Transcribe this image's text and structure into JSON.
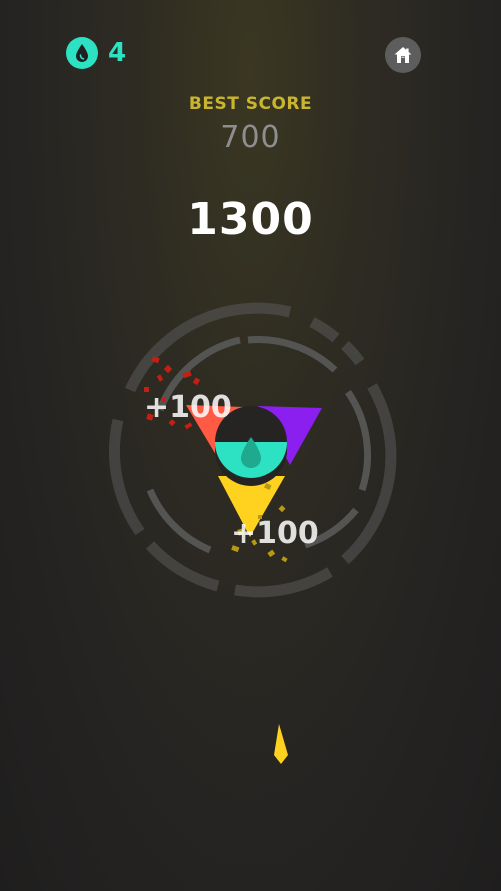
{
  "hud": {
    "drop_icon": "water-drop-icon",
    "drops": "4",
    "home_icon": "home-icon"
  },
  "best": {
    "label": "BEST SCORE",
    "value": "700"
  },
  "score": "1300",
  "popups": {
    "left": "+100",
    "right": "+100"
  },
  "colors": {
    "accent": "#2de2c3",
    "best_label": "#c9b530",
    "red": "#ff5a44",
    "purple": "#8b1ff0",
    "yellow": "#ffd21f",
    "ring": "#5a5a5a"
  }
}
